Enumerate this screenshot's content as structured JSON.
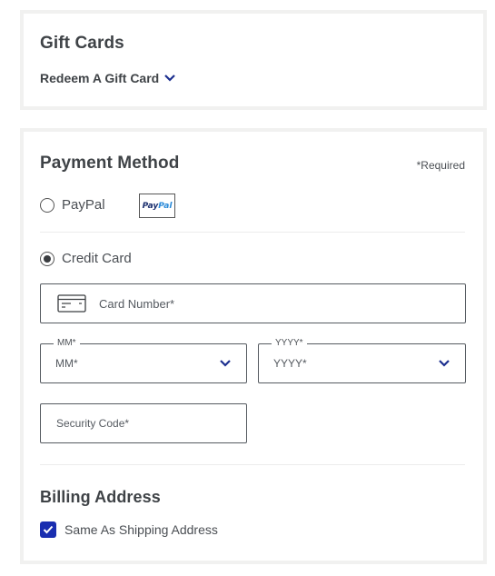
{
  "gift_cards": {
    "title": "Gift Cards",
    "redeem_label": "Redeem A Gift Card",
    "redeem_icon": "chevron-down-icon"
  },
  "payment_method": {
    "title": "Payment Method",
    "required_note": "*Required",
    "options": [
      {
        "label": "PayPal",
        "selected": false,
        "logo_text_pay": "Pay",
        "logo_text_pal": "Pal"
      },
      {
        "label": "Credit Card",
        "selected": true
      }
    ],
    "card_number": {
      "placeholder": "Card Number*",
      "icon": "credit-card-icon",
      "value": ""
    },
    "month": {
      "legend": "MM*",
      "selected": "MM*",
      "icon": "chevron-down-icon"
    },
    "year": {
      "legend": "YYYY*",
      "selected": "YYYY*",
      "icon": "chevron-down-icon"
    },
    "security_code": {
      "placeholder": "Security Code*",
      "value": ""
    }
  },
  "billing_address": {
    "title": "Billing Address",
    "same_as_shipping": {
      "label": "Same As Shipping Address",
      "checked": true
    }
  },
  "colors": {
    "accent": "#1a2eb0",
    "chevron": "#1c2f8f",
    "text": "#3f4347",
    "card_border": "#f1f1f0"
  }
}
